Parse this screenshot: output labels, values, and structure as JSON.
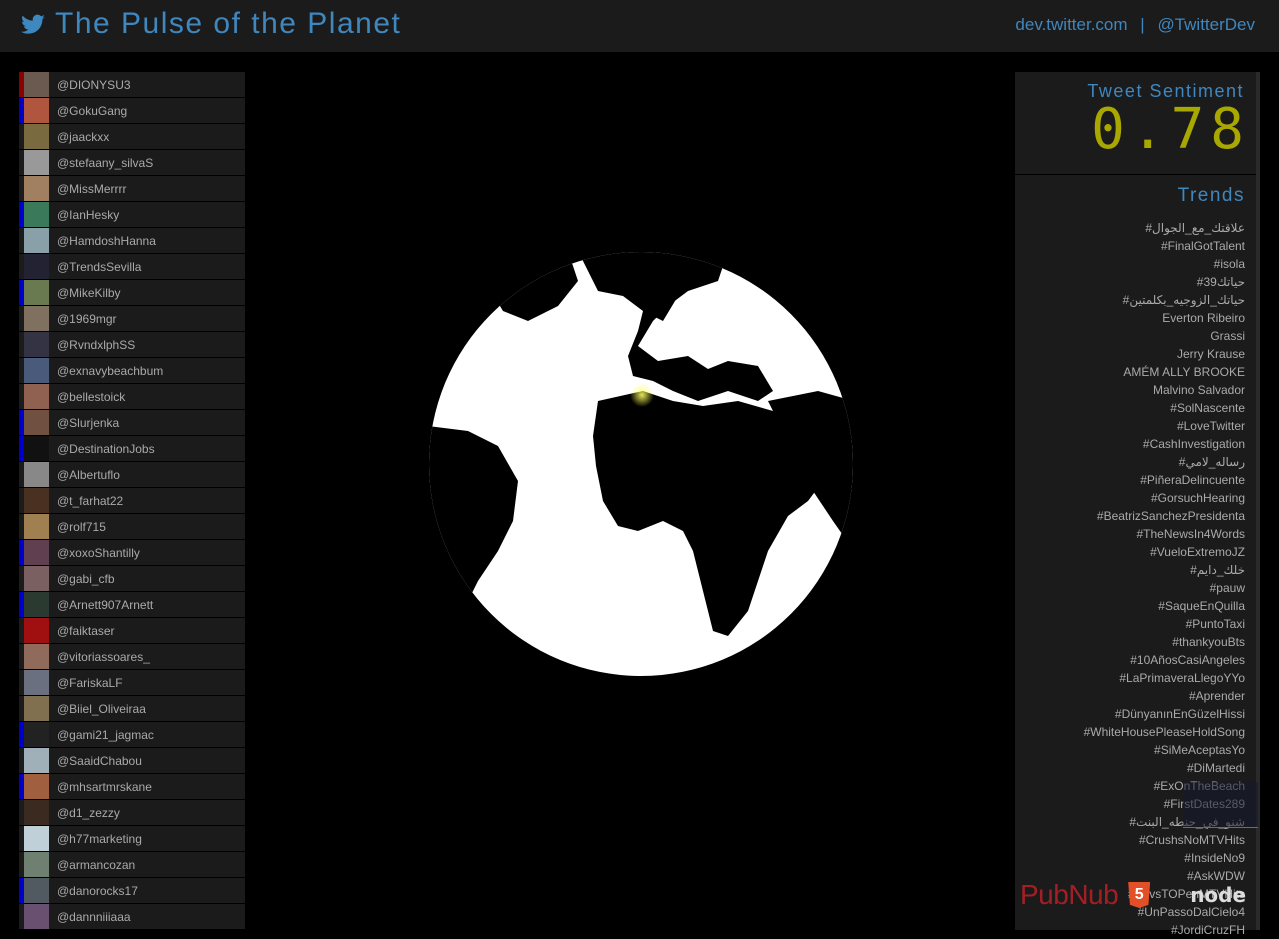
{
  "header": {
    "title": "The Pulse of the Planet",
    "icon": "twitter-bird-icon",
    "link1": "dev.twitter.com",
    "separator": "|",
    "link2": "@TwitterDev"
  },
  "colors": {
    "accent": "#3f87bf",
    "sentiment": "#a9a800",
    "negative": "#8b0000",
    "positive": "#0000c8"
  },
  "users": [
    {
      "handle": "@DIONYSU3",
      "mood": "negative",
      "avatar": "#6b5a50"
    },
    {
      "handle": "@GokuGang",
      "mood": "positive",
      "avatar": "#b0553e"
    },
    {
      "handle": "@jaackxx",
      "mood": "none",
      "avatar": "#7a6a40"
    },
    {
      "handle": "@stefaany_silvaS",
      "mood": "none",
      "avatar": "#999"
    },
    {
      "handle": "@MissMerrrr",
      "mood": "none",
      "avatar": "#a08060"
    },
    {
      "handle": "@IanHesky",
      "mood": "positive",
      "avatar": "#3a7a5a"
    },
    {
      "handle": "@HamdoshHanna",
      "mood": "none",
      "avatar": "#8aa0a8"
    },
    {
      "handle": "@TrendsSevilla",
      "mood": "none",
      "avatar": "#223"
    },
    {
      "handle": "@MikeKilby",
      "mood": "positive",
      "avatar": "#6a7a50"
    },
    {
      "handle": "@1969mgr",
      "mood": "none",
      "avatar": "#807060"
    },
    {
      "handle": "@RvndxlphSS",
      "mood": "none",
      "avatar": "#334"
    },
    {
      "handle": "@exnavybeachbum",
      "mood": "none",
      "avatar": "#4a5a7a"
    },
    {
      "handle": "@bellestoick",
      "mood": "none",
      "avatar": "#906050"
    },
    {
      "handle": "@Slurjenka",
      "mood": "positive",
      "avatar": "#705040"
    },
    {
      "handle": "@DestinationJobs",
      "mood": "positive",
      "avatar": "#111"
    },
    {
      "handle": "@Albertuflo",
      "mood": "none",
      "avatar": "#888"
    },
    {
      "handle": "@t_farhat22",
      "mood": "none",
      "avatar": "#4a3020"
    },
    {
      "handle": "@rolf715",
      "mood": "none",
      "avatar": "#a08050"
    },
    {
      "handle": "@xoxoShantilly",
      "mood": "positive",
      "avatar": "#604050"
    },
    {
      "handle": "@gabi_cfb",
      "mood": "none",
      "avatar": "#7a6060"
    },
    {
      "handle": "@Arnett907Arnett",
      "mood": "positive",
      "avatar": "#2a3a30"
    },
    {
      "handle": "@faiktaser",
      "mood": "none",
      "avatar": "#a01010"
    },
    {
      "handle": "@vitoriassoares_",
      "mood": "none",
      "avatar": "#906a5a"
    },
    {
      "handle": "@FariskaLF",
      "mood": "none",
      "avatar": "#6a7080"
    },
    {
      "handle": "@Biiel_Oliveiraa",
      "mood": "none",
      "avatar": "#807050"
    },
    {
      "handle": "@gami21_jagmac",
      "mood": "positive",
      "avatar": "#222"
    },
    {
      "handle": "@SaaidChabou",
      "mood": "none",
      "avatar": "#a0b0b8"
    },
    {
      "handle": "@mhsartmrskane",
      "mood": "positive",
      "avatar": "#a06040"
    },
    {
      "handle": "@d1_zezzy",
      "mood": "none",
      "avatar": "#3a2a20"
    },
    {
      "handle": "@h77marketing",
      "mood": "none",
      "avatar": "#c0d0d8"
    },
    {
      "handle": "@armancozan",
      "mood": "none",
      "avatar": "#708070"
    },
    {
      "handle": "@danorocks17",
      "mood": "positive",
      "avatar": "#505a60"
    },
    {
      "handle": "@dannniiiaaa",
      "mood": "none",
      "avatar": "#6a5070"
    }
  ],
  "sentiment": {
    "label": "Tweet Sentiment",
    "value": "0.78"
  },
  "trends": {
    "label": "Trends",
    "items": [
      "#علاقتك_مع_الجوال",
      "#FinalGotTalent",
      "#isola",
      "#حياتك39",
      "#حياتك_الزوجيه_بكلمتين",
      "Everton Ribeiro",
      "Grassi",
      "Jerry Krause",
      "AMÉM ALLY BROOKE",
      "Malvino Salvador",
      "#SolNascente",
      "#LoveTwitter",
      "#CashInvestigation",
      "#رساله_لامي",
      "#PiñeraDelincuente",
      "#GorsuchHearing",
      "#BeatrizSanchezPresidenta",
      "#TheNewsIn4Words",
      "#VueloExtremoJZ",
      "#خلك_دايم",
      "#pauw",
      "#SaqueEnQuilla",
      "#PuntoTaxi",
      "#thankyouBts",
      "#10AñosCasiAngeles",
      "#LaPrimaveraLlegoYYo",
      "#Aprender",
      "#DünyanınEnGüzelHissi",
      "#WhiteHousePleaseHoldSong",
      "#SiMeAceptasYo",
      "#DiMartedi",
      "#ExOnTheBeach",
      "#FirstDates289",
      "#شنو_في_جنطه_البنت",
      "#CrushsNoMTVHits",
      "#InsideNo9",
      "#AskWDW",
      "#5SvsTOPenMTVHits",
      "#UnPassoDalCielo4",
      "#JordiCruzFH"
    ]
  },
  "brands": {
    "pubnub": "PubNub",
    "html5": "5",
    "node": "node"
  }
}
